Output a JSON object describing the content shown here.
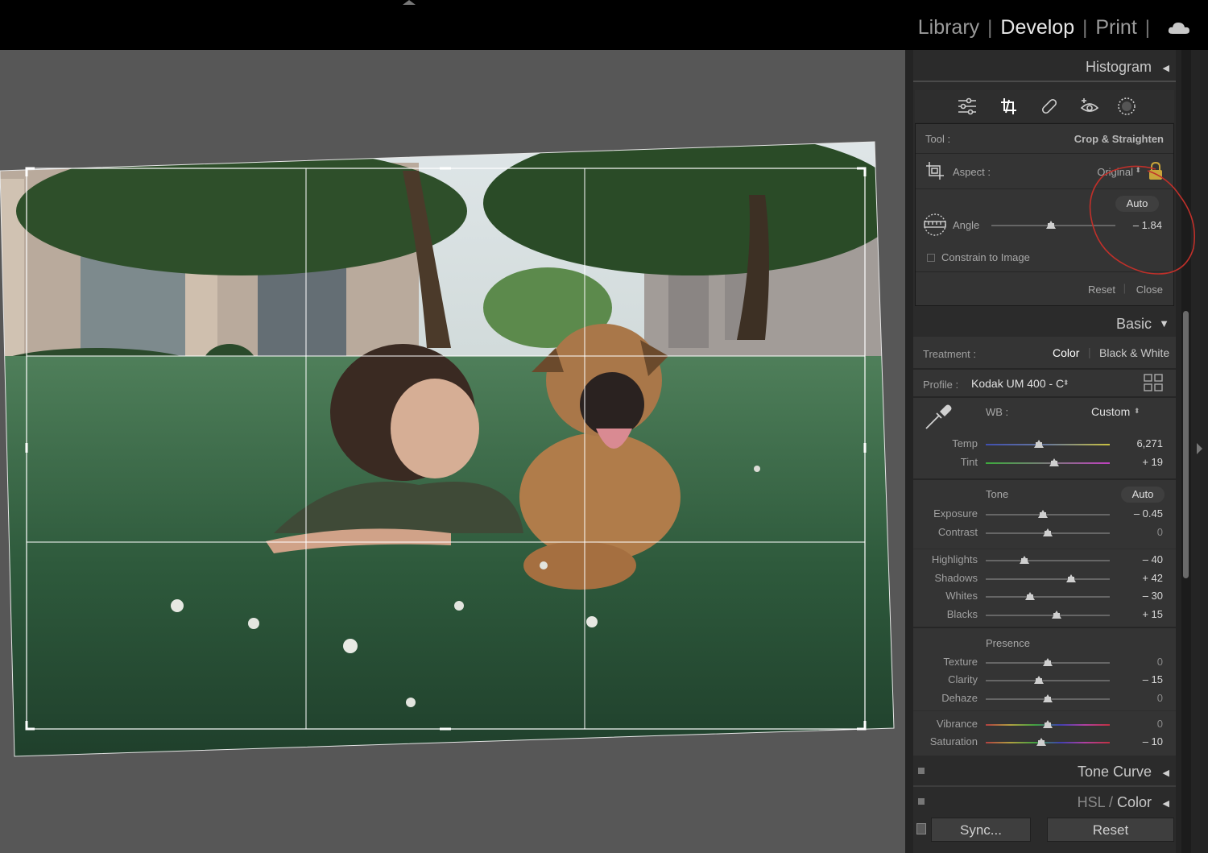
{
  "topbar": {
    "modules": [
      "Library",
      "Develop",
      "Print"
    ],
    "active_module": "Develop",
    "cloud_icon": "cloud-icon"
  },
  "panels": {
    "histogram": "Histogram",
    "basic": "Basic",
    "tone_curve": "Tone Curve",
    "hsl": "HSL",
    "hsl_color": "Color"
  },
  "tools": [
    "sliders-icon",
    "crop-icon",
    "healing-icon",
    "redeye-icon",
    "masking-icon"
  ],
  "crop": {
    "tool_label": "Tool :",
    "tool_name": "Crop & Straighten",
    "aspect_label": "Aspect :",
    "aspect_value": "Original",
    "auto": "Auto",
    "angle_label": "Angle",
    "angle_value": "– 1.84",
    "angle_slider": 0.48,
    "constrain": "Constrain to Image",
    "reset": "Reset",
    "close": "Close"
  },
  "basic": {
    "treatment_label": "Treatment :",
    "treatment_color": "Color",
    "treatment_bw": "Black & White",
    "profile_label": "Profile :",
    "profile_value": "Kodak UM 400 - C",
    "wb_label": "WB :",
    "wb_value": "Custom",
    "tone_label": "Tone",
    "tone_auto": "Auto",
    "presence_label": "Presence",
    "sliders": [
      {
        "label": "Temp",
        "value": "6,271",
        "pos": 0.43
      },
      {
        "label": "Tint",
        "value": "+ 19",
        "pos": 0.55
      },
      {
        "label": "Exposure",
        "value": "– 0.45",
        "pos": 0.46
      },
      {
        "label": "Contrast",
        "value": "0",
        "pos": 0.5
      },
      {
        "label": "Highlights",
        "value": "– 40",
        "pos": 0.31
      },
      {
        "label": "Shadows",
        "value": "+ 42",
        "pos": 0.69
      },
      {
        "label": "Whites",
        "value": "– 30",
        "pos": 0.36
      },
      {
        "label": "Blacks",
        "value": "+ 15",
        "pos": 0.57
      },
      {
        "label": "Texture",
        "value": "0",
        "pos": 0.5
      },
      {
        "label": "Clarity",
        "value": "– 15",
        "pos": 0.43
      },
      {
        "label": "Dehaze",
        "value": "0",
        "pos": 0.5
      },
      {
        "label": "Vibrance",
        "value": "0",
        "pos": 0.5
      },
      {
        "label": "Saturation",
        "value": "– 10",
        "pos": 0.45
      }
    ]
  },
  "bottom": {
    "sync": "Sync...",
    "reset": "Reset"
  },
  "colors": {
    "annotation": "#c0302a",
    "lock": "#c9a43a"
  }
}
